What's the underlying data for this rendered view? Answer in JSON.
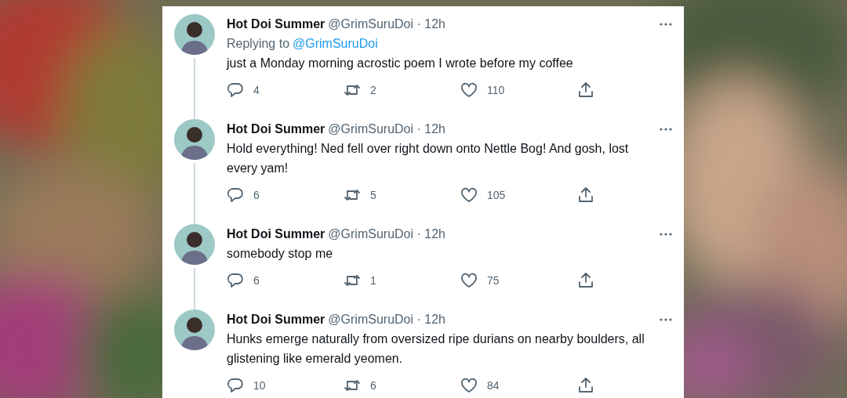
{
  "tweets": [
    {
      "name": "Hot Doi Summer",
      "meta": "@GrimSuruDoi · 12h",
      "replying_label": "Replying to",
      "replying_to": "@GrimSuruDoi",
      "text": "just a Monday morning acrostic poem I wrote before my coffee",
      "replies": "4",
      "retweets": "2",
      "likes": "110",
      "connected": true
    },
    {
      "name": "Hot Doi Summer",
      "meta": "@GrimSuruDoi · 12h",
      "text": "Hold everything! Ned fell over right down onto Nettle Bog! And gosh, lost every yam!",
      "replies": "6",
      "retweets": "5",
      "likes": "105",
      "connected": true
    },
    {
      "name": "Hot Doi Summer",
      "meta": "@GrimSuruDoi · 12h",
      "text": "somebody stop me",
      "replies": "6",
      "retweets": "1",
      "likes": "75",
      "connected": true
    },
    {
      "name": "Hot Doi Summer",
      "meta": "@GrimSuruDoi · 12h",
      "text": "Hunks emerge naturally from oversized ripe durians on nearby boulders, all glistening like emerald yeomen.",
      "replies": "10",
      "retweets": "6",
      "likes": "84",
      "connected": false
    }
  ]
}
